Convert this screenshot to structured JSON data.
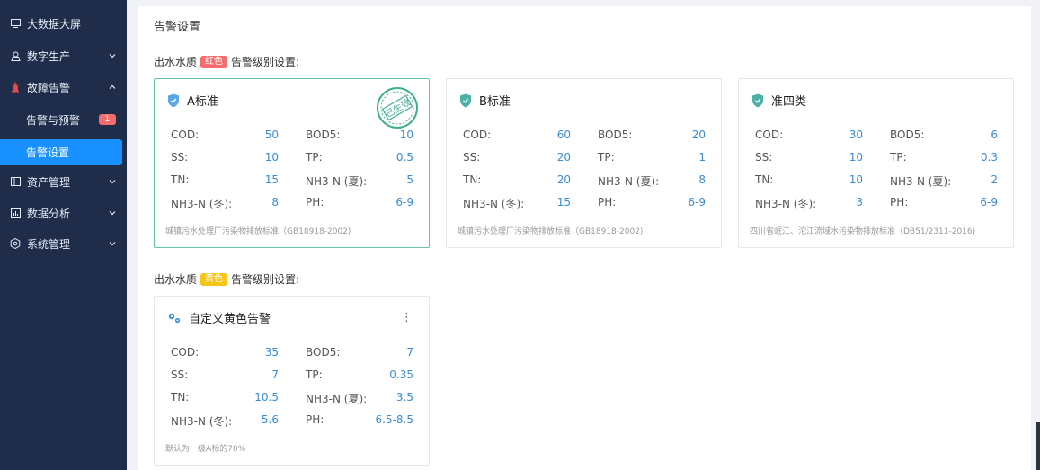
{
  "sidebar": {
    "items": [
      {
        "label": "大数据大屏",
        "icon": "monitor-icon",
        "chevron": false
      },
      {
        "label": "数字生产",
        "icon": "user-hat-icon",
        "chevron": "down"
      },
      {
        "label": "故障告警",
        "icon": "alarm-light-icon",
        "chevron": "up"
      },
      {
        "label": "资产管理",
        "icon": "asset-icon",
        "chevron": "down"
      },
      {
        "label": "数据分析",
        "icon": "chart-box-icon",
        "chevron": "down"
      },
      {
        "label": "系统管理",
        "icon": "gear-icon",
        "chevron": "down"
      }
    ],
    "subitems": [
      {
        "label": "告警与预警",
        "badge": "1"
      },
      {
        "label": "告警设置",
        "active": true
      }
    ]
  },
  "page": {
    "title": "告警设置"
  },
  "red_section": {
    "prefix": "出水水质",
    "tag": "红色",
    "suffix": "告警级别设置:"
  },
  "yellow_section": {
    "prefix": "出水水质",
    "tag": "黄色",
    "suffix": "告警级别设置:"
  },
  "stamp_text": "已生效",
  "cards": [
    {
      "title": "A标准",
      "params": [
        {
          "k1": "COD:",
          "v1": "50",
          "k2": "BOD5:",
          "v2": "10"
        },
        {
          "k1": "SS:",
          "v1": "10",
          "k2": "TP:",
          "v2": "0.5"
        },
        {
          "k1": "TN:",
          "v1": "15",
          "k2": "NH3-N (夏):",
          "v2": "5"
        },
        {
          "k1": "NH3-N (冬):",
          "v1": "8",
          "k2": "PH:",
          "v2": "6-9"
        }
      ],
      "note": "城镇污水处理厂污染物排放标准（GB18918-2002)"
    },
    {
      "title": "B标准",
      "params": [
        {
          "k1": "COD:",
          "v1": "60",
          "k2": "BOD5:",
          "v2": "20"
        },
        {
          "k1": "SS:",
          "v1": "20",
          "k2": "TP:",
          "v2": "1"
        },
        {
          "k1": "TN:",
          "v1": "20",
          "k2": "NH3-N (夏):",
          "v2": "8"
        },
        {
          "k1": "NH3-N (冬):",
          "v1": "15",
          "k2": "PH:",
          "v2": "6-9"
        }
      ],
      "note": "城镇污水处理厂污染物排放标准（GB18918-2002)"
    },
    {
      "title": "准四类",
      "params": [
        {
          "k1": "COD:",
          "v1": "30",
          "k2": "BOD5:",
          "v2": "6"
        },
        {
          "k1": "SS:",
          "v1": "10",
          "k2": "TP:",
          "v2": "0.3"
        },
        {
          "k1": "TN:",
          "v1": "10",
          "k2": "NH3-N (夏):",
          "v2": "2"
        },
        {
          "k1": "NH3-N (冬):",
          "v1": "3",
          "k2": "PH:",
          "v2": "6-9"
        }
      ],
      "note": "四川省岷江、沱江流域水污染物排放标准（DB51/2311-2016)"
    },
    {
      "title": "自定义黄色告警",
      "params": [
        {
          "k1": "COD:",
          "v1": "35",
          "k2": "BOD5:",
          "v2": "7"
        },
        {
          "k1": "SS:",
          "v1": "7",
          "k2": "TP:",
          "v2": "0.35"
        },
        {
          "k1": "TN:",
          "v1": "10.5",
          "k2": "NH3-N (夏):",
          "v2": "3.5"
        },
        {
          "k1": "NH3-N (冬):",
          "v1": "5.6",
          "k2": "PH:",
          "v2": "6.5-8.5"
        }
      ],
      "note": "默认为一级A标的70%"
    }
  ],
  "colors": {
    "sidebar_bg": "#1f2d4b",
    "active": "#1890ff",
    "value": "#3b8cd6",
    "stamp": "#3fae8d",
    "red_tag": "#f56c6c",
    "yellow_tag": "#f5c518"
  }
}
